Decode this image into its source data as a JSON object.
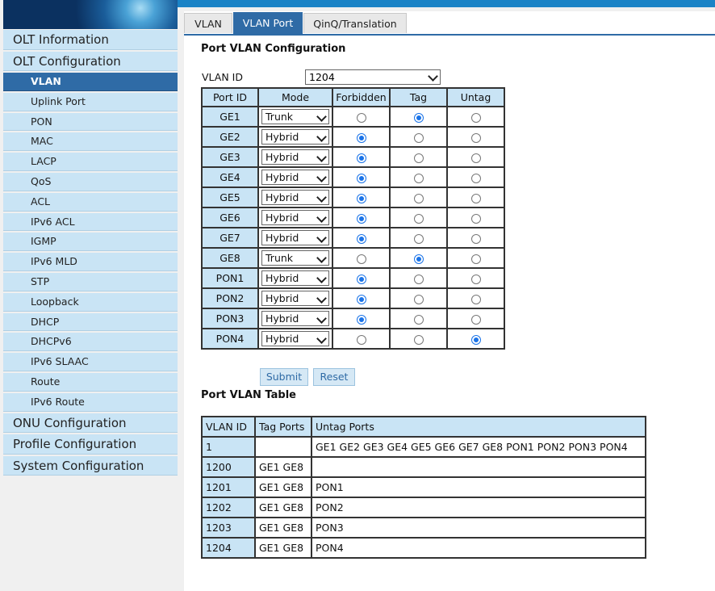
{
  "sidebar": {
    "top_items": [
      "OLT Information",
      "OLT Configuration"
    ],
    "sub_items": [
      "VLAN",
      "Uplink Port",
      "PON",
      "MAC",
      "LACP",
      "QoS",
      "ACL",
      "IPv6 ACL",
      "IGMP",
      "IPv6 MLD",
      "STP",
      "Loopback",
      "DHCP",
      "DHCPv6",
      "IPv6 SLAAC",
      "Route",
      "IPv6 Route"
    ],
    "bottom_items": [
      "ONU Configuration",
      "Profile Configuration",
      "System Configuration"
    ],
    "active_sub": "VLAN"
  },
  "tabs": [
    "VLAN",
    "VLAN Port",
    "QinQ/Translation"
  ],
  "active_tab": "VLAN Port",
  "config": {
    "heading": "Port VLAN Configuration",
    "vlan_id_label": "VLAN ID",
    "vlan_id_value": "1204",
    "headers": [
      "Port ID",
      "Mode",
      "Forbidden",
      "Tag",
      "Untag"
    ],
    "rows": [
      {
        "port": "GE1",
        "mode": "Trunk",
        "selected": "Tag"
      },
      {
        "port": "GE2",
        "mode": "Hybrid",
        "selected": "Forbidden"
      },
      {
        "port": "GE3",
        "mode": "Hybrid",
        "selected": "Forbidden"
      },
      {
        "port": "GE4",
        "mode": "Hybrid",
        "selected": "Forbidden"
      },
      {
        "port": "GE5",
        "mode": "Hybrid",
        "selected": "Forbidden"
      },
      {
        "port": "GE6",
        "mode": "Hybrid",
        "selected": "Forbidden"
      },
      {
        "port": "GE7",
        "mode": "Hybrid",
        "selected": "Forbidden"
      },
      {
        "port": "GE8",
        "mode": "Trunk",
        "selected": "Tag"
      },
      {
        "port": "PON1",
        "mode": "Hybrid",
        "selected": "Forbidden"
      },
      {
        "port": "PON2",
        "mode": "Hybrid",
        "selected": "Forbidden"
      },
      {
        "port": "PON3",
        "mode": "Hybrid",
        "selected": "Forbidden"
      },
      {
        "port": "PON4",
        "mode": "Hybrid",
        "selected": "Untag"
      }
    ],
    "submit_label": "Submit",
    "reset_label": "Reset"
  },
  "table": {
    "heading": "Port VLAN Table",
    "headers": [
      "VLAN ID",
      "Tag Ports",
      "Untag Ports"
    ],
    "rows": [
      {
        "vlan": "1",
        "tag": "",
        "untag": "GE1 GE2 GE3 GE4 GE5 GE6 GE7 GE8 PON1 PON2 PON3 PON4"
      },
      {
        "vlan": "1200",
        "tag": "GE1 GE8",
        "untag": ""
      },
      {
        "vlan": "1201",
        "tag": "GE1 GE8",
        "untag": "PON1"
      },
      {
        "vlan": "1202",
        "tag": "GE1 GE8",
        "untag": "PON2"
      },
      {
        "vlan": "1203",
        "tag": "GE1 GE8",
        "untag": "PON3"
      },
      {
        "vlan": "1204",
        "tag": "GE1 GE8",
        "untag": "PON4"
      }
    ]
  },
  "colors": {
    "accent": "#2f6ba6",
    "cell_bg": "#c9e4f5",
    "topbar": "#1a83c6",
    "radio": "#1a73e8"
  }
}
